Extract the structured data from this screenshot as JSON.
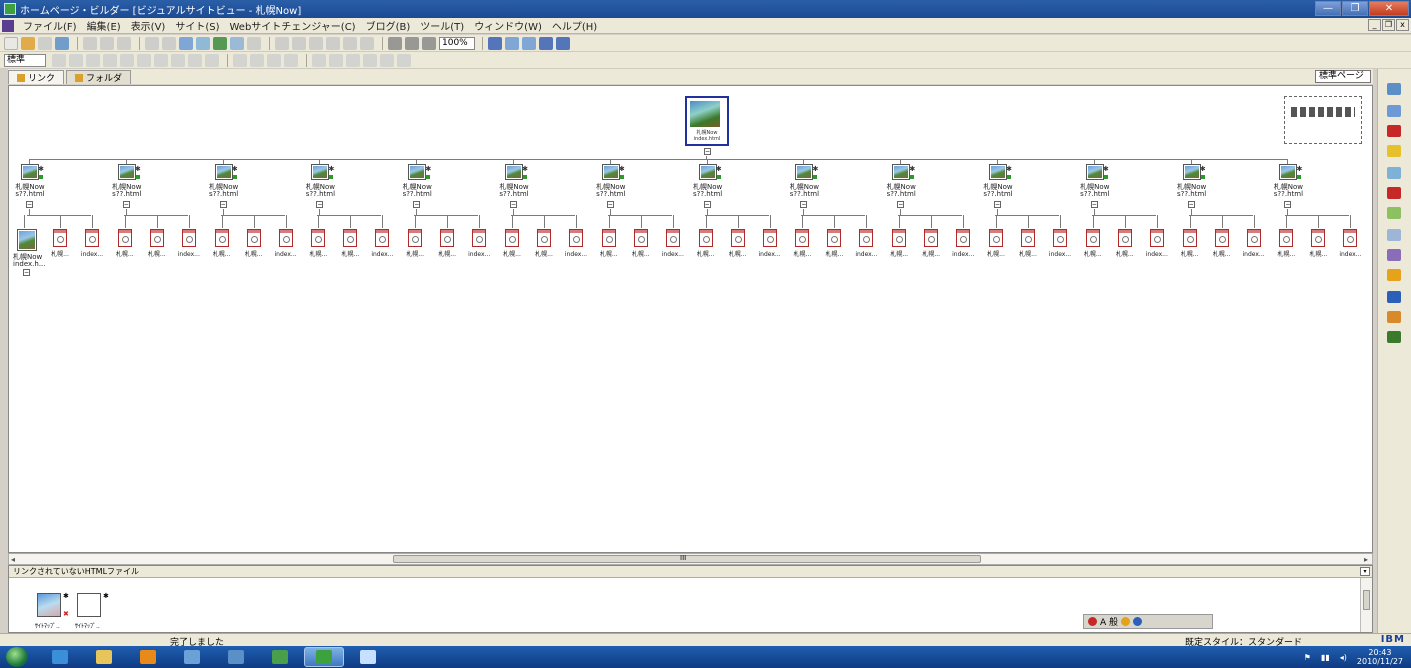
{
  "window": {
    "title": "ホームページ・ビルダー [ビジュアルサイトビュー - 札幌Now]",
    "buttons": {
      "minimize": "—",
      "maximize": "❐",
      "close": "✕"
    }
  },
  "menu": {
    "items": [
      "ファイル(F)",
      "編集(E)",
      "表示(V)",
      "サイト(S)",
      "Webサイトチェンジャー(C)",
      "ブログ(B)",
      "ツール(T)",
      "ウィンドウ(W)",
      "ヘルプ(H)"
    ],
    "mdi": [
      "_",
      "❐",
      "x"
    ]
  },
  "toolbar": {
    "zoom": "100%",
    "style": "標準"
  },
  "tabs": [
    {
      "label": "リンク",
      "active": true
    },
    {
      "label": "フォルダ",
      "active": false
    }
  ],
  "view_select": "標準ページ",
  "site": {
    "root": {
      "label": "札幌Now\nindex.html"
    },
    "level1": [
      {
        "label": "札幌Now",
        "file": "s??.html"
      },
      {
        "label": "札幌Now",
        "file": "s??.html"
      },
      {
        "label": "札幌Now",
        "file": "s??.html"
      },
      {
        "label": "札幌Now",
        "file": "s??.html"
      },
      {
        "label": "札幌Now",
        "file": "s??.html"
      },
      {
        "label": "札幌Now",
        "file": "s??.html"
      },
      {
        "label": "札幌Now",
        "file": "s??.html"
      },
      {
        "label": "札幌Now",
        "file": "s??.html"
      },
      {
        "label": "札幌Now",
        "file": "s??.html"
      },
      {
        "label": "札幌Now",
        "file": "s??.html"
      },
      {
        "label": "札幌Now",
        "file": "s??.html"
      },
      {
        "label": "札幌Now",
        "file": "s??.html"
      },
      {
        "label": "札幌Now",
        "file": "s??.html"
      },
      {
        "label": "札幌Now",
        "file": "s??.html"
      }
    ],
    "first_child": {
      "label": "札幌Now",
      "file": "index.h..."
    },
    "link_labels": [
      "札幌...",
      "札幌...",
      "index..."
    ]
  },
  "bottom_panel": {
    "title": "リンクされていないHTMLファイル",
    "files": [
      {
        "label": "ｻｲﾄﾏｯﾌﾟ.."
      },
      {
        "label": "ｻｲﾄﾏｯﾌﾟ.."
      }
    ]
  },
  "hscroll_label": "III",
  "ime": {
    "mode": "A 般"
  },
  "status": {
    "message": "完了しました",
    "style": "既定スタイル：スタンダード",
    "brand": "IBM"
  },
  "taskbar": {
    "time": "20:43",
    "date": "2010/11/27"
  },
  "colors": {
    "title_bar": "#1c4a93",
    "link_border": "#b02a2a",
    "root_border": "#2330a0",
    "taskbar": "#1f5eb0"
  }
}
